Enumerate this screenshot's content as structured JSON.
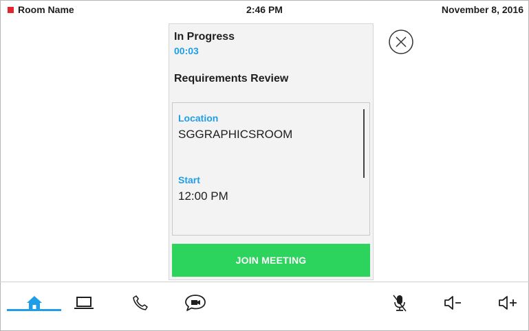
{
  "status_bar": {
    "room_name": "Room Name",
    "time": "2:46 PM",
    "date": "November 8, 2016"
  },
  "meeting": {
    "status": "In Progress",
    "elapsed": "00:03",
    "title": "Requirements Review",
    "location_label": "Location",
    "location_value": "SGGRAPHICSROOM",
    "start_label": "Start",
    "start_value": "12:00 PM",
    "join_label": "JOIN MEETING"
  },
  "bottom_nav": {
    "items": [
      "home-icon",
      "laptop-icon",
      "phone-icon",
      "chat-video-icon"
    ],
    "active": "home-icon"
  },
  "audio_controls": [
    "mic-mute-icon",
    "volume-down-icon",
    "volume-up-icon"
  ],
  "colors": {
    "accent": "#1f9ee6",
    "join": "#2cd35c",
    "room_indicator": "#e4242e"
  }
}
